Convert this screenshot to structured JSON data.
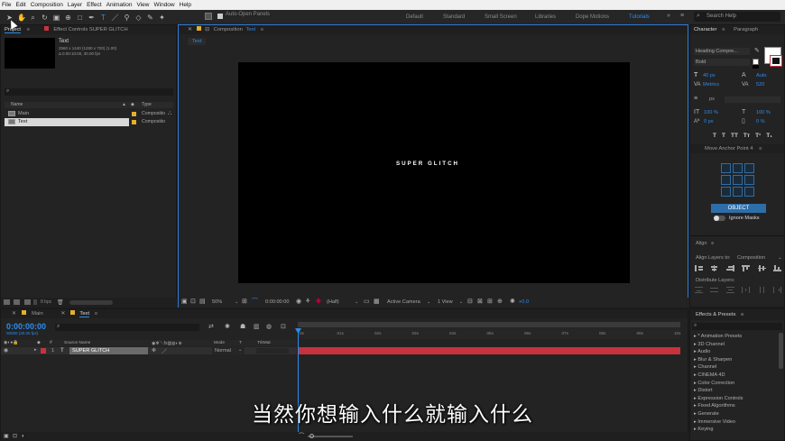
{
  "menu": [
    "File",
    "Edit",
    "Composition",
    "Layer",
    "Effect",
    "Animation",
    "View",
    "Window",
    "Help"
  ],
  "toolbar": {
    "auto_open": "Auto-Open Panels"
  },
  "workspaces": [
    {
      "label": "Default",
      "active": false
    },
    {
      "label": "Standard",
      "active": false
    },
    {
      "label": "Small Screen",
      "active": false
    },
    {
      "label": "Libraries",
      "active": false
    },
    {
      "label": "Dope Motions",
      "active": false
    },
    {
      "label": "Tutorials",
      "active": true
    }
  ],
  "search_help": "Search Help",
  "project": {
    "tab_project": "Project",
    "tab_effect": "Effect Controls SUPER GLITCH",
    "preview_name": "Text",
    "preview_info1": "2560 x 1440 (1280 x 720) (1.00)",
    "preview_info2": "Δ 0:00:10:00, 30.00 fps",
    "col_name": "Name",
    "col_type": "Type",
    "items": [
      {
        "name": "Main",
        "type": "Compositio"
      },
      {
        "name": "Text",
        "type": "Compositio"
      }
    ],
    "bpc": "8 bpc"
  },
  "comp": {
    "tab": "Composition",
    "tab_name": "Text",
    "subtab": "Text",
    "canvas_text": "SUPER GLITCH",
    "zoom": "50%",
    "timecode": "0:00:00:00",
    "resolution": "(Half)",
    "camera": "Active Camera",
    "views": "1 View",
    "exposure": "+0.0"
  },
  "character": {
    "tab": "Character",
    "tab2": "Paragraph",
    "font": "Heading Compre...",
    "style": "Bold",
    "size": "40 px",
    "leading": "Auto",
    "kerning": "Metrics",
    "tracking": "520",
    "stroke": "px",
    "vscale": "100 %",
    "hscale": "100 %",
    "baseline": "0 px",
    "tsume": "0 %",
    "styles": [
      "T",
      "T",
      "TT",
      "Tт",
      "T¹",
      "T₁"
    ]
  },
  "anchor": {
    "title": "Move Anchor Point 4",
    "object_btn": "OBJECT",
    "ignore": "Ignore Masks"
  },
  "align": {
    "title": "Align",
    "align_to_label": "Align Layers to:",
    "align_to": "Composition",
    "distribute": "Distribute Layers:"
  },
  "effects": {
    "title": "Effects & Presets",
    "items": [
      "* Animation Presets",
      "3D Channel",
      "Audio",
      "Blur & Sharpen",
      "Channel",
      "CINEMA 4D",
      "Color Correction",
      "Distort",
      "Expression Controls",
      "Fixed Algorithms",
      "Generate",
      "Immersive Video",
      "Keying"
    ]
  },
  "timeline": {
    "tabs": [
      "Main",
      "Text"
    ],
    "timecode": "0:00:00:00",
    "fps": "00000 (30.00 fps)",
    "col_source": "Source Name",
    "col_mode": "Mode",
    "col_trkmat": "TrkMat",
    "layer_num": "1",
    "layer_name": "SUPER GLITCH",
    "layer_mode": "Normal",
    "ruler": [
      "0s",
      "01s",
      "02s",
      "03s",
      "04s",
      "05s",
      "06s",
      "07s",
      "08s",
      "09s",
      "10s"
    ]
  },
  "subtitle": "当然你想输入什么就输入什么",
  "colors": {
    "accent": "#2d8ceb",
    "layer_bar": "#c8323c",
    "label_red": "#c8323c",
    "label_yellow": "#e0b030"
  }
}
